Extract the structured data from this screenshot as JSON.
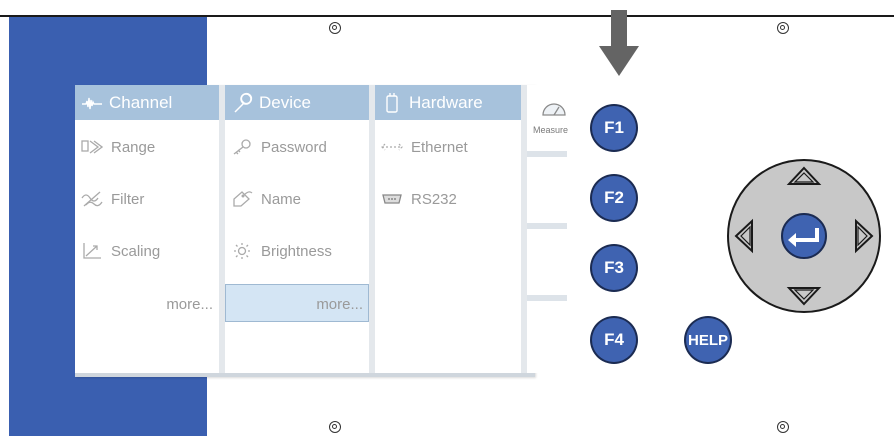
{
  "menu": {
    "columns": [
      {
        "title": "Channel",
        "icon": "waveform-icon",
        "items": [
          {
            "label": "Range",
            "icon": "range-icon"
          },
          {
            "label": "Filter",
            "icon": "filter-icon"
          },
          {
            "label": "Scaling",
            "icon": "scaling-icon"
          }
        ],
        "more": "more..."
      },
      {
        "title": "Device",
        "icon": "wrench-icon",
        "items": [
          {
            "label": "Password",
            "icon": "key-icon"
          },
          {
            "label": "Name",
            "icon": "tag-icon"
          },
          {
            "label": "Brightness",
            "icon": "sun-icon"
          }
        ],
        "more": "more..."
      },
      {
        "title": "Hardware",
        "icon": "device-icon",
        "items": [
          {
            "label": "Ethernet",
            "icon": "ethernet-icon"
          },
          {
            "label": "RS232",
            "icon": "serial-port-icon"
          }
        ]
      }
    ],
    "side_tab": {
      "label": "Measure",
      "icon": "gauge-icon"
    }
  },
  "keys": {
    "f1": "F1",
    "f2": "F2",
    "f3": "F3",
    "f4": "F4",
    "help": "HELP"
  },
  "colors": {
    "panel_blue": "#3a5fb0",
    "header_blue": "#a7c2dc",
    "key_blue": "#3f63b1",
    "selected_bg": "#d4e5f4"
  }
}
